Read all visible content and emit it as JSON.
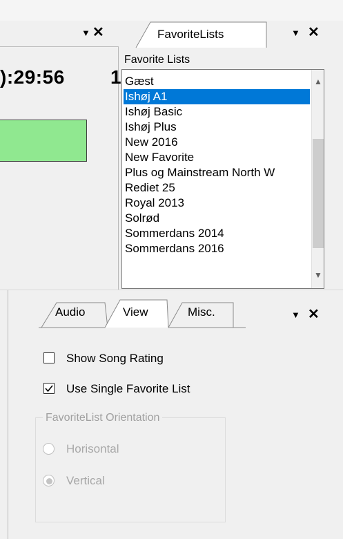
{
  "left_panel": {
    "time_text": "):29:56",
    "extra_text": "1"
  },
  "favorites_panel": {
    "tab_label": "FavoriteLists",
    "heading": "Favorite Lists",
    "items": [
      "Gæst",
      "Ishøj A1",
      "Ishøj Basic",
      "Ishøj Plus",
      "New 2016",
      "New Favorite",
      "Plus og Mainstream North W",
      "Rediet 25",
      "Royal 2013",
      "Solrød",
      "Sommerdans 2014",
      "Sommerdans 2016"
    ],
    "selected_index": 1
  },
  "settings_panel": {
    "tabs": [
      "Audio",
      "View",
      "Misc."
    ],
    "active_tab": "View",
    "show_song_rating": {
      "label": "Show Song Rating",
      "checked": false
    },
    "use_single_favorite_list": {
      "label": "Use Single Favorite List",
      "checked": true
    },
    "orientation_group": {
      "label": "FavoriteList Orientation",
      "options": [
        "Horisontal",
        "Vertical"
      ],
      "selected": "Vertical"
    }
  },
  "icons": {
    "dropdown": "caret-down-icon",
    "close": "close-icon",
    "checkmark": "check-icon"
  },
  "colors": {
    "selection": "#0078d7",
    "green_indicator": "#90e890"
  }
}
